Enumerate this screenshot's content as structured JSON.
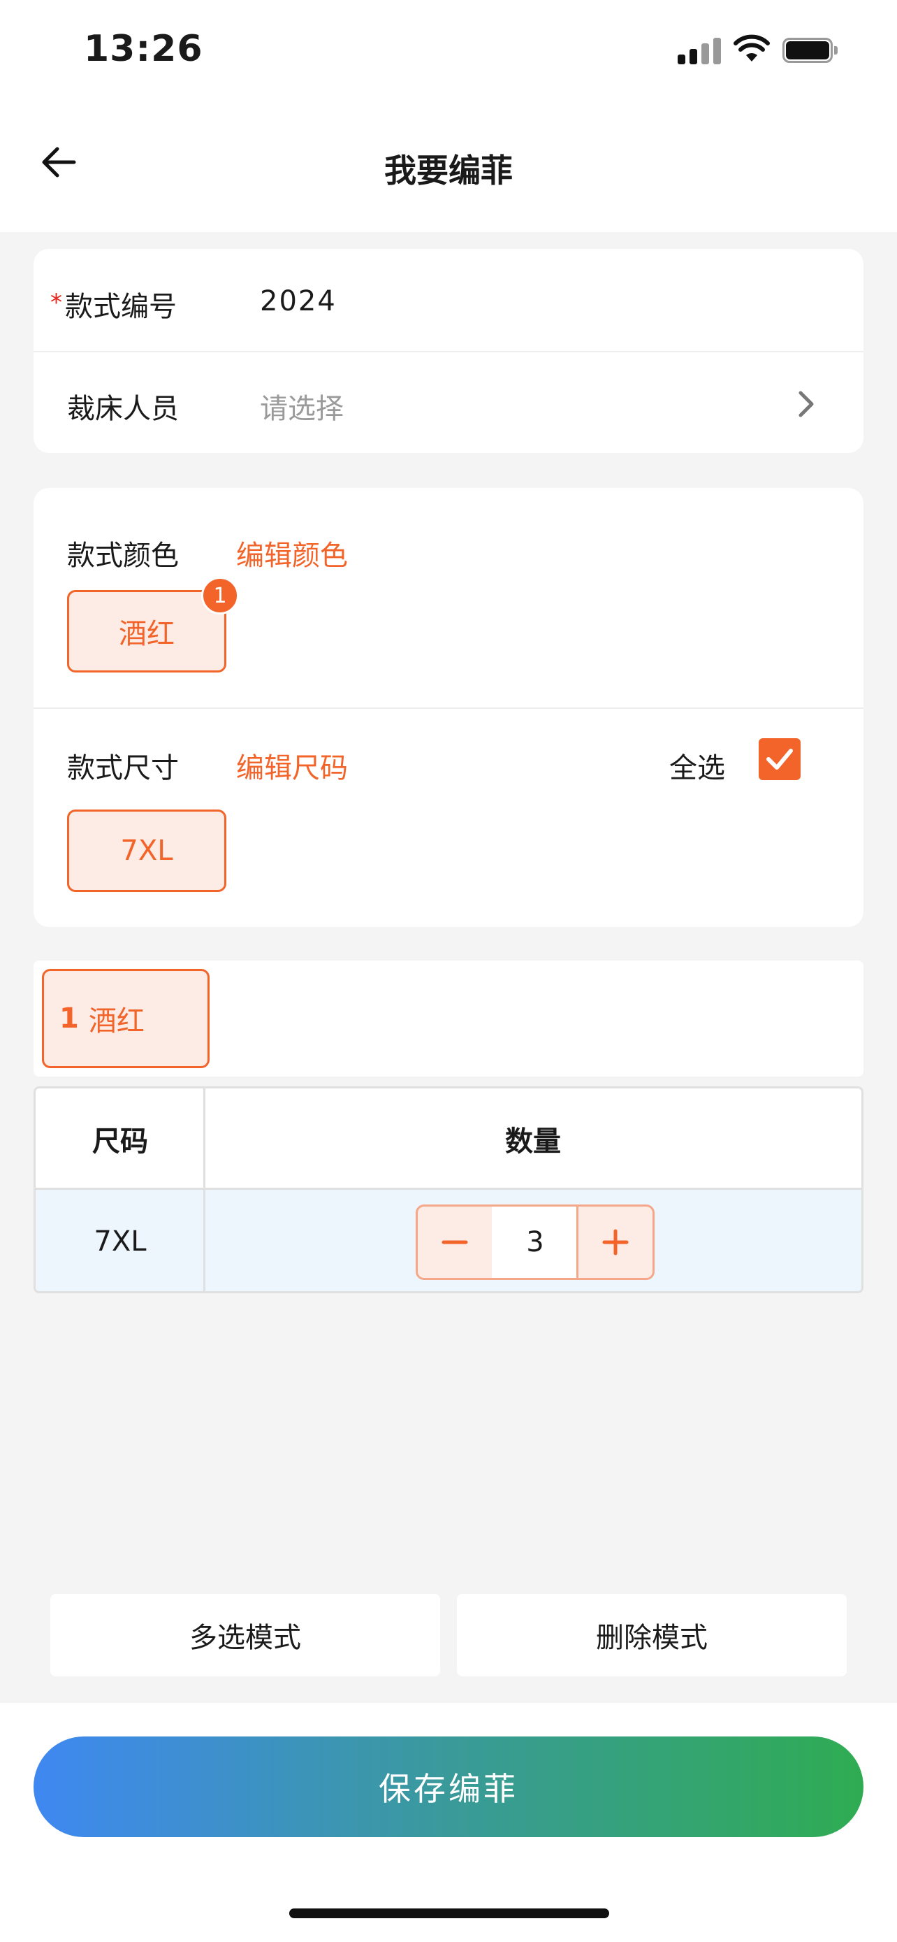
{
  "status_bar": {
    "time": "13:26"
  },
  "header": {
    "title": "我要编菲",
    "back_icon": "arrow-left-icon"
  },
  "form": {
    "style_number": {
      "required_mark": "*",
      "label": "款式编号",
      "value": "2024"
    },
    "cutter": {
      "label": "裁床人员",
      "placeholder": "请选择",
      "chevron_icon": "chevron-right-icon"
    }
  },
  "color_section": {
    "label": "款式颜色",
    "edit_link": "编辑颜色",
    "chips": [
      {
        "label": "酒红",
        "badge": "1"
      }
    ]
  },
  "size_section": {
    "label": "款式尺寸",
    "edit_link": "编辑尺码",
    "select_all_label": "全选",
    "select_all_checked": true,
    "chips": [
      {
        "label": "7XL"
      }
    ]
  },
  "color_tabs": [
    {
      "index": "1",
      "label": "酒红"
    }
  ],
  "table": {
    "headers": {
      "size": "尺码",
      "quantity": "数量"
    },
    "rows": [
      {
        "size": "7XL",
        "quantity": "3"
      }
    ]
  },
  "mode_buttons": {
    "multi_select": "多选模式",
    "delete": "删除模式"
  },
  "save_button": {
    "label": "保存编菲"
  },
  "colors": {
    "accent": "#f2642a",
    "accent_light": "#fdebe5",
    "gradient_start": "#3f88f2",
    "gradient_end": "#2fac52"
  }
}
